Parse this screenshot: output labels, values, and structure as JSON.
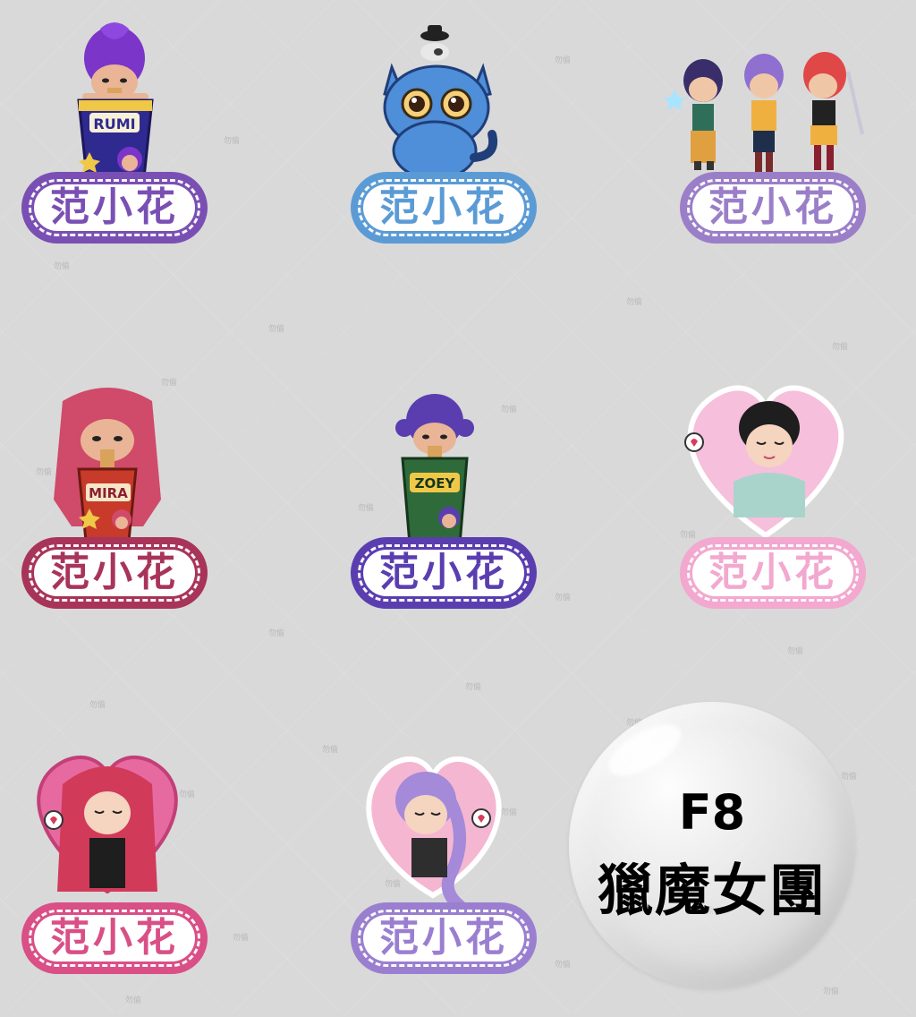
{
  "watermark": "勿偷",
  "stickers": [
    {
      "name": "rumi-noodle-cup",
      "cup_text": "RUMI",
      "label": "范小花",
      "theme_color": "#7a4fb3",
      "icon": "noodle-cup-girl-icon"
    },
    {
      "name": "blue-cat",
      "label": "范小花",
      "theme_color": "#5b9bd5",
      "icon": "blue-cat-icon"
    },
    {
      "name": "trio-girls",
      "label": "范小花",
      "theme_color": "#9b7ec8",
      "icon": "three-girls-icon"
    },
    {
      "name": "mira-noodle-cup",
      "cup_text": "MIRA",
      "label": "范小花",
      "theme_color": "#a8345a",
      "icon": "noodle-cup-girl-icon"
    },
    {
      "name": "zoey-noodle-cup",
      "cup_text": "ZOEY",
      "label": "范小花",
      "theme_color": "#5a3eb0",
      "icon": "noodle-cup-girl-icon"
    },
    {
      "name": "heart-girl-black-hair",
      "label": "范小花",
      "theme_color": "#f2a8cf",
      "icon": "heart-portrait-icon"
    },
    {
      "name": "heart-girl-red-hair",
      "label": "范小花",
      "theme_color": "#d94f86",
      "icon": "heart-portrait-icon"
    },
    {
      "name": "heart-girl-purple-braid",
      "label": "范小花",
      "theme_color": "#9a7fd0",
      "icon": "heart-portrait-icon"
    }
  ],
  "bubble": {
    "title": "F8",
    "subtitle": "獵魔女團"
  }
}
